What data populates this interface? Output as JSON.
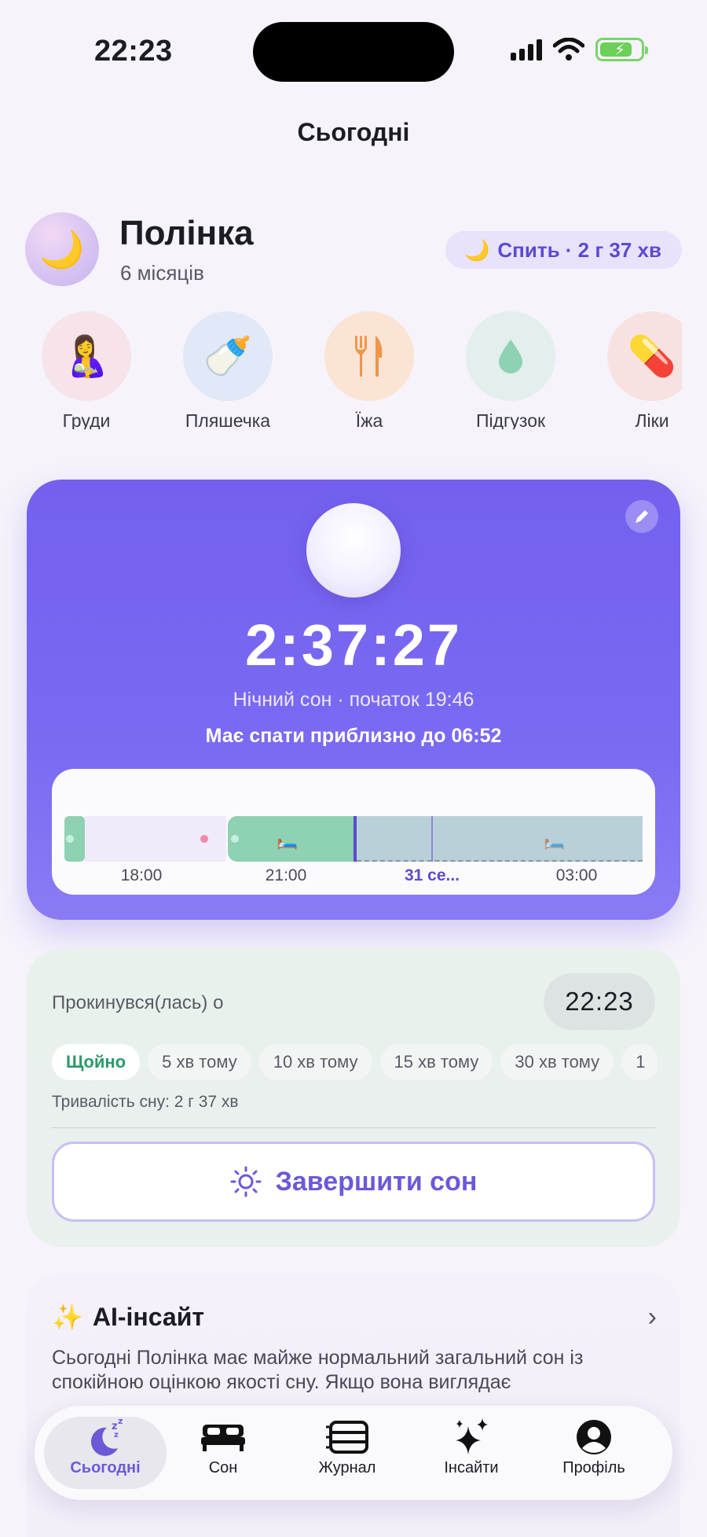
{
  "status_bar": {
    "time": "22:23"
  },
  "page": {
    "title": "Сьогодні"
  },
  "baby": {
    "avatar_emoji": "🌙",
    "name": "Полінка",
    "age": "6 місяців",
    "status_emoji": "🌙",
    "status_text": "Спить · 2 г 37 хв"
  },
  "quick_actions": [
    {
      "label": "Груди",
      "emoji": "🤱",
      "color": "#f7e3ea"
    },
    {
      "label": "Пляшечка",
      "emoji": "🍼",
      "color": "#e1e8f8"
    },
    {
      "label": "Їжа",
      "emoji": "🍴",
      "color": "#fbe4d4"
    },
    {
      "label": "Підгузок",
      "emoji": "💧",
      "color": "#e2efec"
    },
    {
      "label": "Ліки",
      "emoji": "💊",
      "color": "#f8e1e1"
    }
  ],
  "timer": {
    "value": "2:37:27",
    "subtitle": "Нічний сон · початок 19:46",
    "expected": "Має спати приблизно до 06:52",
    "timeline_labels": [
      "18:00",
      "21:00",
      "31 се...",
      "03:00"
    ]
  },
  "wake": {
    "label": "Прокинувся(лась) о",
    "time": "22:23",
    "chips": [
      "Щойно",
      "5 хв тому",
      "10 хв тому",
      "15 хв тому",
      "30 хв тому",
      "1"
    ],
    "duration": "Тривалість сну: 2 г 37 хв",
    "finish_label": "Завершити сон"
  },
  "ai": {
    "title": "AI-інсайт",
    "text": "Сьогодні Полінка має майже нормальний загальний сон із спокійною оцінкою якості сну. Якщо вона виглядає"
  },
  "tabs": [
    {
      "label": "Сьогодні",
      "active": true
    },
    {
      "label": "Сон",
      "active": false
    },
    {
      "label": "Журнал",
      "active": false
    },
    {
      "label": "Інсайти",
      "active": false
    },
    {
      "label": "Профіль",
      "active": false
    }
  ],
  "colors": {
    "accent": "#6a5ad8",
    "sleep_green": "#8fd1b3",
    "planned": "#b9d0d9"
  }
}
